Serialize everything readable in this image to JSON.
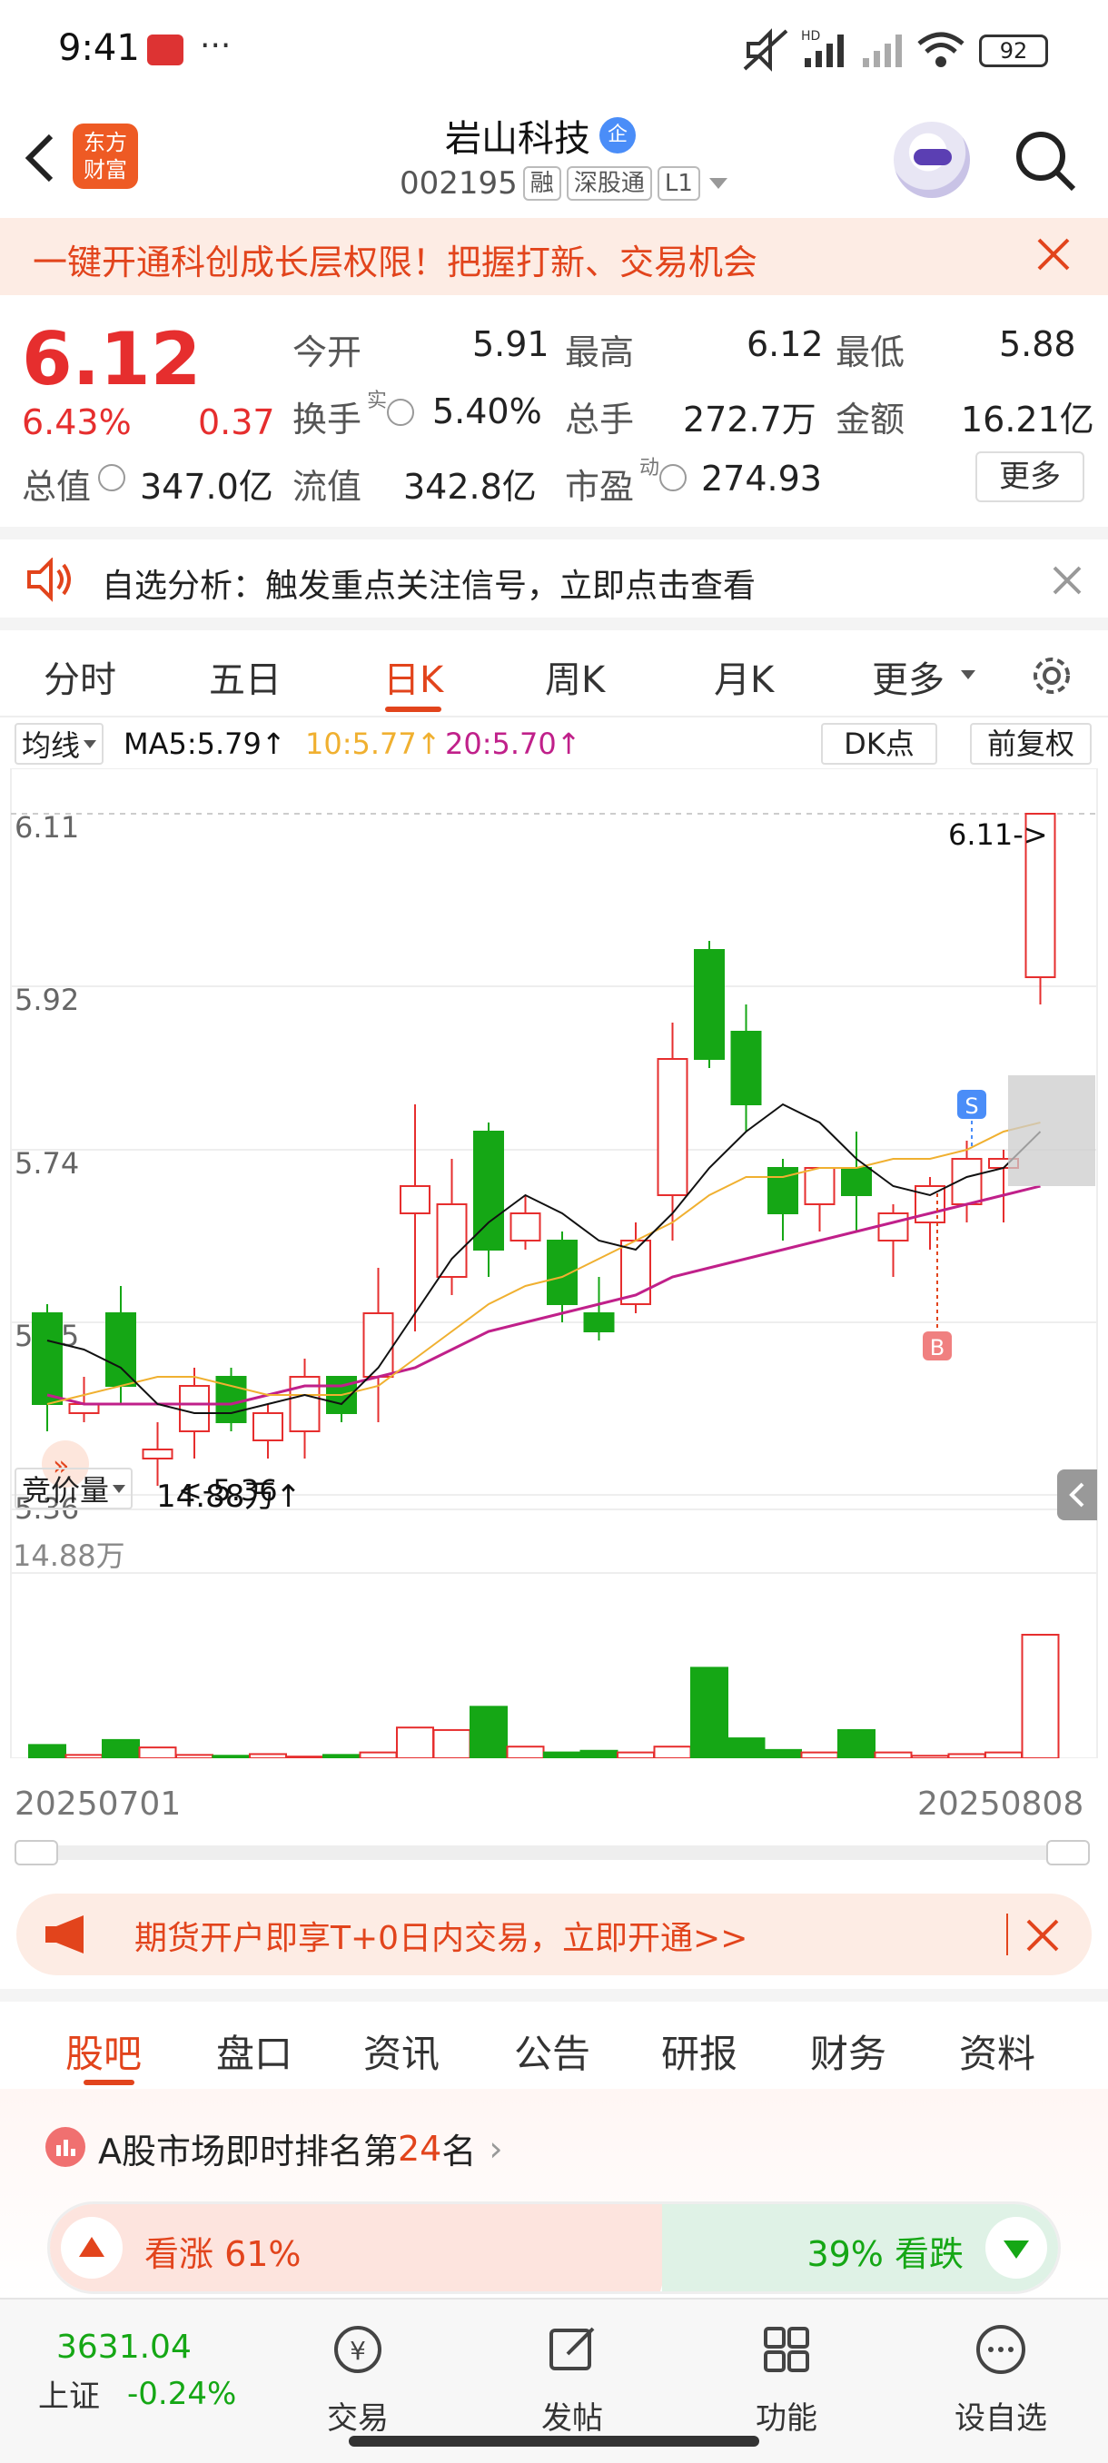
{
  "status": {
    "time": "9:41",
    "battery": "92",
    "signal_hd": "HD"
  },
  "header": {
    "brand_line1": "东方",
    "brand_line2": "财富",
    "stock_name": "岩山科技",
    "stock_badge": "企",
    "stock_code": "002195",
    "tags": [
      "融",
      "深股通",
      "L1"
    ]
  },
  "banner": {
    "text": "一键开通科创成长层权限！把握打新、交易机会"
  },
  "quote": {
    "price": "6.12",
    "change_pct": "6.43%",
    "change": "0.37",
    "open_label": "今开",
    "open": "5.91",
    "high_label": "最高",
    "high": "6.12",
    "low_label": "最低",
    "low": "5.88",
    "turnover_label": "换手",
    "turnover_sup": "实",
    "turnover": "5.40%",
    "volume_label": "总手",
    "volume": "272.7万",
    "amount_label": "金额",
    "amount": "16.21亿",
    "mktcap_label": "总值",
    "mktcap": "347.0亿",
    "float_label": "流值",
    "float": "342.8亿",
    "pe_label": "市盈",
    "pe_sup": "动",
    "pe": "274.93",
    "more_label": "更多"
  },
  "analysis": {
    "text": "自选分析：触发重点关注信号，立即点击查看"
  },
  "period_tabs": {
    "items": [
      "分时",
      "五日",
      "日K",
      "周K",
      "月K",
      "更多"
    ],
    "active": "日K"
  },
  "chart_toolbar": {
    "ma_select": "均线",
    "ma5": "MA5:5.79↑",
    "ma10": "10:5.77↑",
    "ma20": "20:5.70↑",
    "dk_label": "DK点",
    "adjust_label": "前复权"
  },
  "chart_labels": {
    "max_marker": "6.11->",
    "min_marker": "<-5.36",
    "signal_s": "S",
    "signal_b": "B",
    "vol_select": "竞价量",
    "vol_value": "14.88万↑",
    "vol_axis_max": "14.88万",
    "date_start": "20250701",
    "date_end": "20250808"
  },
  "chart_data": {
    "type": "candlestick",
    "yticks": [
      "6.11",
      "5.92",
      "5.74",
      "5.55",
      "5.36"
    ],
    "ylim": [
      5.36,
      6.11
    ],
    "colors": {
      "up": "#e62e2e",
      "down": "#15a715",
      "ma5": "#111111",
      "ma10": "#f0b030",
      "ma20": "#c0208a"
    },
    "candles": [
      {
        "o": 5.56,
        "c": 5.46,
        "h": 5.57,
        "l": 5.43,
        "v": 1.6
      },
      {
        "o": 5.45,
        "c": 5.46,
        "h": 5.49,
        "l": 5.44,
        "v": 0.4
      },
      {
        "o": 5.56,
        "c": 5.48,
        "h": 5.59,
        "l": 5.46,
        "v": 2.2
      },
      {
        "o": 5.4,
        "c": 5.41,
        "h": 5.44,
        "l": 5.37,
        "v": 1.3
      },
      {
        "o": 5.43,
        "c": 5.48,
        "h": 5.5,
        "l": 5.4,
        "v": 0.4
      },
      {
        "o": 5.49,
        "c": 5.44,
        "h": 5.5,
        "l": 5.43,
        "v": 0.3
      },
      {
        "o": 5.42,
        "c": 5.45,
        "h": 5.46,
        "l": 5.4,
        "v": 0.5
      },
      {
        "o": 5.43,
        "c": 5.49,
        "h": 5.51,
        "l": 5.4,
        "v": 0.2
      },
      {
        "o": 5.49,
        "c": 5.45,
        "h": 5.49,
        "l": 5.44,
        "v": 0.4
      },
      {
        "o": 5.49,
        "c": 5.56,
        "h": 5.61,
        "l": 5.44,
        "v": 0.7
      },
      {
        "o": 5.67,
        "c": 5.7,
        "h": 5.79,
        "l": 5.54,
        "v": 3.7
      },
      {
        "o": 5.6,
        "c": 5.68,
        "h": 5.73,
        "l": 5.58,
        "v": 3.4
      },
      {
        "o": 5.76,
        "c": 5.63,
        "h": 5.77,
        "l": 5.6,
        "v": 6.2
      },
      {
        "o": 5.64,
        "c": 5.67,
        "h": 5.69,
        "l": 5.63,
        "v": 1.4
      },
      {
        "o": 5.64,
        "c": 5.57,
        "h": 5.65,
        "l": 5.55,
        "v": 0.7
      },
      {
        "o": 5.56,
        "c": 5.54,
        "h": 5.6,
        "l": 5.53,
        "v": 0.9
      },
      {
        "o": 5.57,
        "c": 5.64,
        "h": 5.66,
        "l": 5.56,
        "v": 0.7
      },
      {
        "o": 5.69,
        "c": 5.84,
        "h": 5.88,
        "l": 5.64,
        "v": 1.4
      },
      {
        "o": 5.96,
        "c": 5.84,
        "h": 5.97,
        "l": 5.83,
        "v": 10.9
      },
      {
        "o": 5.87,
        "c": 5.79,
        "h": 5.9,
        "l": 5.76,
        "v": 2.4
      },
      {
        "o": 5.72,
        "c": 5.67,
        "h": 5.73,
        "l": 5.64,
        "v": 1.0
      },
      {
        "o": 5.68,
        "c": 5.72,
        "h": 5.72,
        "l": 5.65,
        "v": 0.7
      },
      {
        "o": 5.72,
        "c": 5.69,
        "h": 5.76,
        "l": 5.65,
        "v": 3.4
      },
      {
        "o": 5.64,
        "c": 5.67,
        "h": 5.68,
        "l": 5.6,
        "v": 0.7
      },
      {
        "o": 5.66,
        "c": 5.7,
        "h": 5.71,
        "l": 5.63,
        "v": 0.3
      },
      {
        "o": 5.68,
        "c": 5.73,
        "h": 5.75,
        "l": 5.66,
        "v": 0.5
      },
      {
        "o": 5.72,
        "c": 5.73,
        "h": 5.74,
        "l": 5.66,
        "v": 0.7
      },
      {
        "o": 5.93,
        "c": 6.11,
        "h": 6.11,
        "l": 5.9,
        "v": 14.88
      }
    ],
    "ma5": [
      5.53,
      5.52,
      5.5,
      5.46,
      5.45,
      5.45,
      5.46,
      5.47,
      5.46,
      5.5,
      5.56,
      5.62,
      5.66,
      5.69,
      5.67,
      5.64,
      5.63,
      5.67,
      5.72,
      5.76,
      5.79,
      5.77,
      5.73,
      5.7,
      5.69,
      5.71,
      5.72,
      5.76
    ],
    "ma10": [
      5.46,
      5.47,
      5.48,
      5.49,
      5.49,
      5.48,
      5.47,
      5.47,
      5.47,
      5.48,
      5.51,
      5.54,
      5.57,
      5.59,
      5.6,
      5.62,
      5.64,
      5.66,
      5.69,
      5.71,
      5.71,
      5.72,
      5.72,
      5.73,
      5.73,
      5.74,
      5.76,
      5.77
    ],
    "ma20": [
      5.47,
      5.46,
      5.46,
      5.46,
      5.46,
      5.46,
      5.47,
      5.48,
      5.48,
      5.49,
      5.5,
      5.52,
      5.54,
      5.55,
      5.56,
      5.57,
      5.58,
      5.6,
      5.61,
      5.62,
      5.63,
      5.64,
      5.65,
      5.66,
      5.67,
      5.68,
      5.69,
      5.7
    ]
  },
  "promo": {
    "text": "期货开户即享T+0日内交易，立即开通>>"
  },
  "sub_tabs": {
    "items": [
      "股吧",
      "盘口",
      "资讯",
      "公告",
      "研报",
      "财务",
      "资料"
    ],
    "active": "股吧"
  },
  "rank": {
    "prefix": "A股市场即时排名第",
    "rank": "24",
    "suffix": "名",
    "up_label": "看涨 61%",
    "down_label": "39% 看跌"
  },
  "bottom_nav": {
    "index_value": "3631.04",
    "index_name": "上证",
    "index_change": "-0.24%",
    "items": [
      "交易",
      "发帖",
      "功能",
      "设自选"
    ]
  }
}
